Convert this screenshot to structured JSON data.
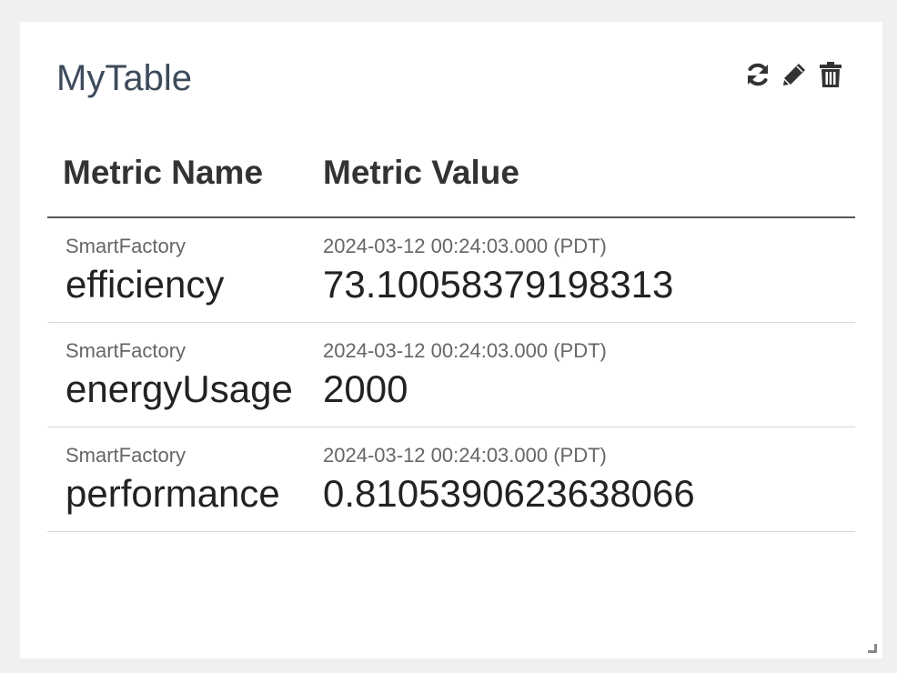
{
  "widget": {
    "title": "MyTable",
    "toolbar": {
      "refresh_icon": "refresh-icon",
      "edit_icon": "pencil-icon",
      "delete_icon": "trash-icon"
    }
  },
  "table": {
    "columns": [
      "Metric Name",
      "Metric Value"
    ],
    "rows": [
      {
        "source": "SmartFactory",
        "name": "efficiency",
        "timestamp": "2024-03-12 00:24:03.000 (PDT)",
        "value": "73.10058379198313"
      },
      {
        "source": "SmartFactory",
        "name": "energyUsage",
        "timestamp": "2024-03-12 00:24:03.000 (PDT)",
        "value": "2000"
      },
      {
        "source": "SmartFactory",
        "name": "performance",
        "timestamp": "2024-03-12 00:24:03.000 (PDT)",
        "value": "0.8105390623638066"
      }
    ]
  },
  "colors": {
    "title": "#3d4b5c",
    "icon": "#333333",
    "background": "#f0f0f0",
    "card": "#ffffff"
  }
}
